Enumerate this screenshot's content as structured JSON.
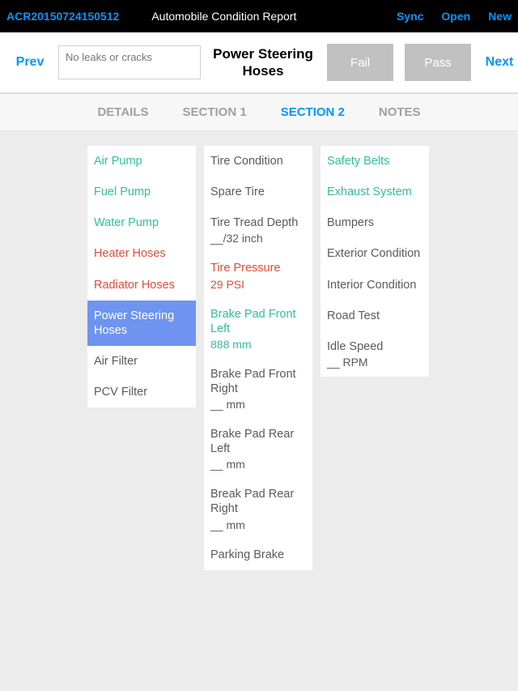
{
  "topbar": {
    "report_id": "ACR20150724150512",
    "title": "Automobile Condition Report",
    "sync": "Sync",
    "open": "Open",
    "new": "New"
  },
  "header": {
    "prev": "Prev",
    "next": "Next",
    "placeholder": "No leaks or cracks",
    "item_title": "Power Steering Hoses",
    "fail": "Fail",
    "pass": "Pass"
  },
  "tabs": {
    "details": "DETAILS",
    "section1": "SECTION 1",
    "section2": "SECTION 2",
    "notes": "NOTES"
  },
  "col1": [
    {
      "label": "Air Pump",
      "status": "green"
    },
    {
      "label": "Fuel Pump",
      "status": "green"
    },
    {
      "label": "Water Pump",
      "status": "green"
    },
    {
      "label": "Heater Hoses",
      "status": "red"
    },
    {
      "label": "Radiator Hoses",
      "status": "red"
    },
    {
      "label": "Power Steering Hoses",
      "status": "selected"
    },
    {
      "label": "Air Filter",
      "status": "gray"
    },
    {
      "label": "PCV Filter",
      "status": "gray"
    }
  ],
  "col2": [
    {
      "label": "Tire Condition",
      "status": "gray"
    },
    {
      "label": "Spare Tire",
      "status": "gray"
    },
    {
      "label": "Tire Tread Depth",
      "sub": "__/32 inch",
      "status": "gray"
    },
    {
      "label": "Tire Pressure",
      "sub": " 29  PSI",
      "status": "red",
      "underline": true
    },
    {
      "label": "Brake Pad Front Left",
      "sub": " 888  mm",
      "status": "green",
      "underline": true
    },
    {
      "label": "Brake Pad Front Right",
      "sub": "__ mm",
      "status": "gray"
    },
    {
      "label": "Brake Pad Rear Left",
      "sub": "__ mm",
      "status": "gray"
    },
    {
      "label": "Break Pad Rear Right",
      "sub": "__ mm",
      "status": "gray"
    },
    {
      "label": "Parking Brake",
      "status": "gray"
    }
  ],
  "col3": [
    {
      "label": "Safety Belts",
      "status": "green"
    },
    {
      "label": "Exhaust System",
      "status": "green"
    },
    {
      "label": "Bumpers",
      "status": "gray"
    },
    {
      "label": "Exterior Condition",
      "status": "gray"
    },
    {
      "label": "Interior Condition",
      "status": "gray"
    },
    {
      "label": "Road Test",
      "status": "gray"
    },
    {
      "label": "Idle Speed",
      "sub": "__ RPM",
      "status": "gray"
    }
  ]
}
